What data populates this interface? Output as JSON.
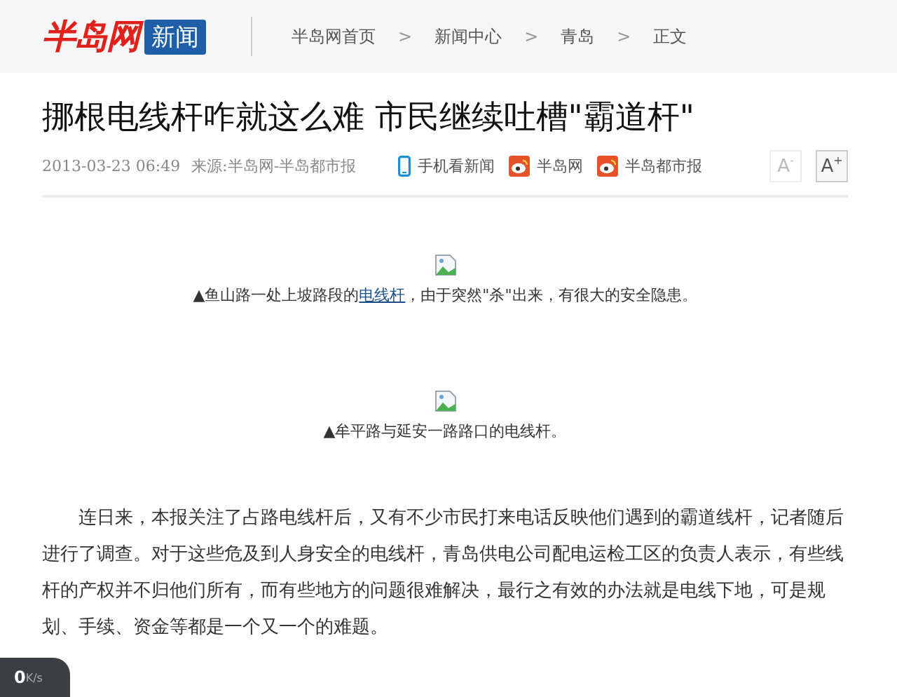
{
  "header": {
    "logo": "半岛网",
    "logo_badge": "新闻",
    "breadcrumb": [
      {
        "label": "半岛网首页"
      },
      {
        "label": "新闻中心"
      },
      {
        "label": "青岛"
      },
      {
        "label": "正文"
      }
    ],
    "separator": ">"
  },
  "article": {
    "title": "挪根电线杆咋就这么难 市民继续吐槽\"霸道杆\"",
    "date": "2013-03-23 06:49",
    "source": "来源:半岛网-半岛都市报",
    "share": [
      {
        "kind": "phone",
        "label": "手机看新闻"
      },
      {
        "kind": "weibo",
        "label": "半岛网"
      },
      {
        "kind": "weibo",
        "label": "半岛都市报"
      }
    ],
    "font_buttons": [
      {
        "label": "A",
        "sup": "-",
        "disabled": true
      },
      {
        "label": "A",
        "sup": "+",
        "disabled": false
      }
    ],
    "figures": [
      {
        "caption_before": "▲鱼山路一处上坡路段的",
        "caption_link": "电线杆",
        "caption_after": "，由于突然\"杀\"出来，有很大的安全隐患。"
      },
      {
        "caption_before": "▲牟平路与延安一路路口的电线杆。"
      }
    ],
    "paragraphs": [
      "连日来，本报关注了占路电线杆后，又有不少市民打来电话反映他们遇到的霸道线杆，记者随后进行了调查。对于这些危及到人身安全的电线杆，青岛供电公司配电运检工区的负责人表示，有些线杆的产权并不归他们所有，而有些地方的问题很难解决，最行之有效的办法就是电线下地，可是规划、手续、资金等都是一个又一个的难题。"
    ]
  },
  "speed_widget": {
    "value": "0",
    "unit": "K/s"
  }
}
